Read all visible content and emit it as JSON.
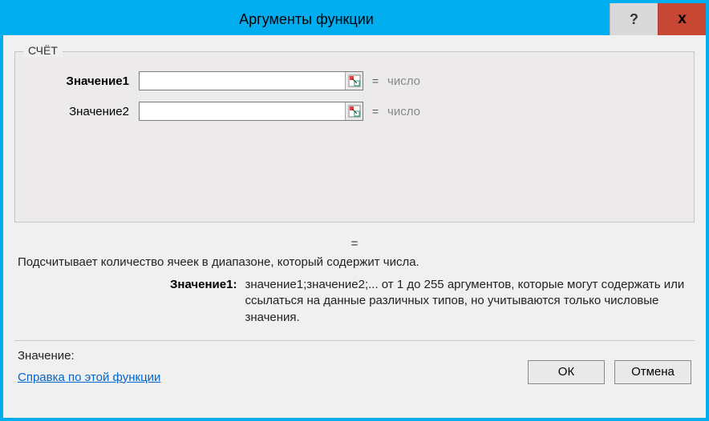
{
  "window": {
    "title": "Аргументы функции"
  },
  "group": {
    "legend": "СЧЁТ",
    "args": [
      {
        "label": "Значение1",
        "value": "",
        "result": "число",
        "bold": true
      },
      {
        "label": "Значение2",
        "value": "",
        "result": "число",
        "bold": false
      }
    ],
    "equals": "="
  },
  "formula_equals": "=",
  "description": "Подсчитывает количество ячеек в диапазоне, который содержит числа.",
  "param": {
    "name": "Значение1:",
    "text": "значение1;значение2;... от 1 до 255 аргументов, которые могут содержать или ссылаться на данные различных типов, но учитываются только числовые значения."
  },
  "value_label": "Значение:",
  "help_link": "Справка по этой функции",
  "buttons": {
    "ok": "ОК",
    "cancel": "Отмена"
  },
  "titlebar": {
    "help": "?",
    "close": "x"
  }
}
